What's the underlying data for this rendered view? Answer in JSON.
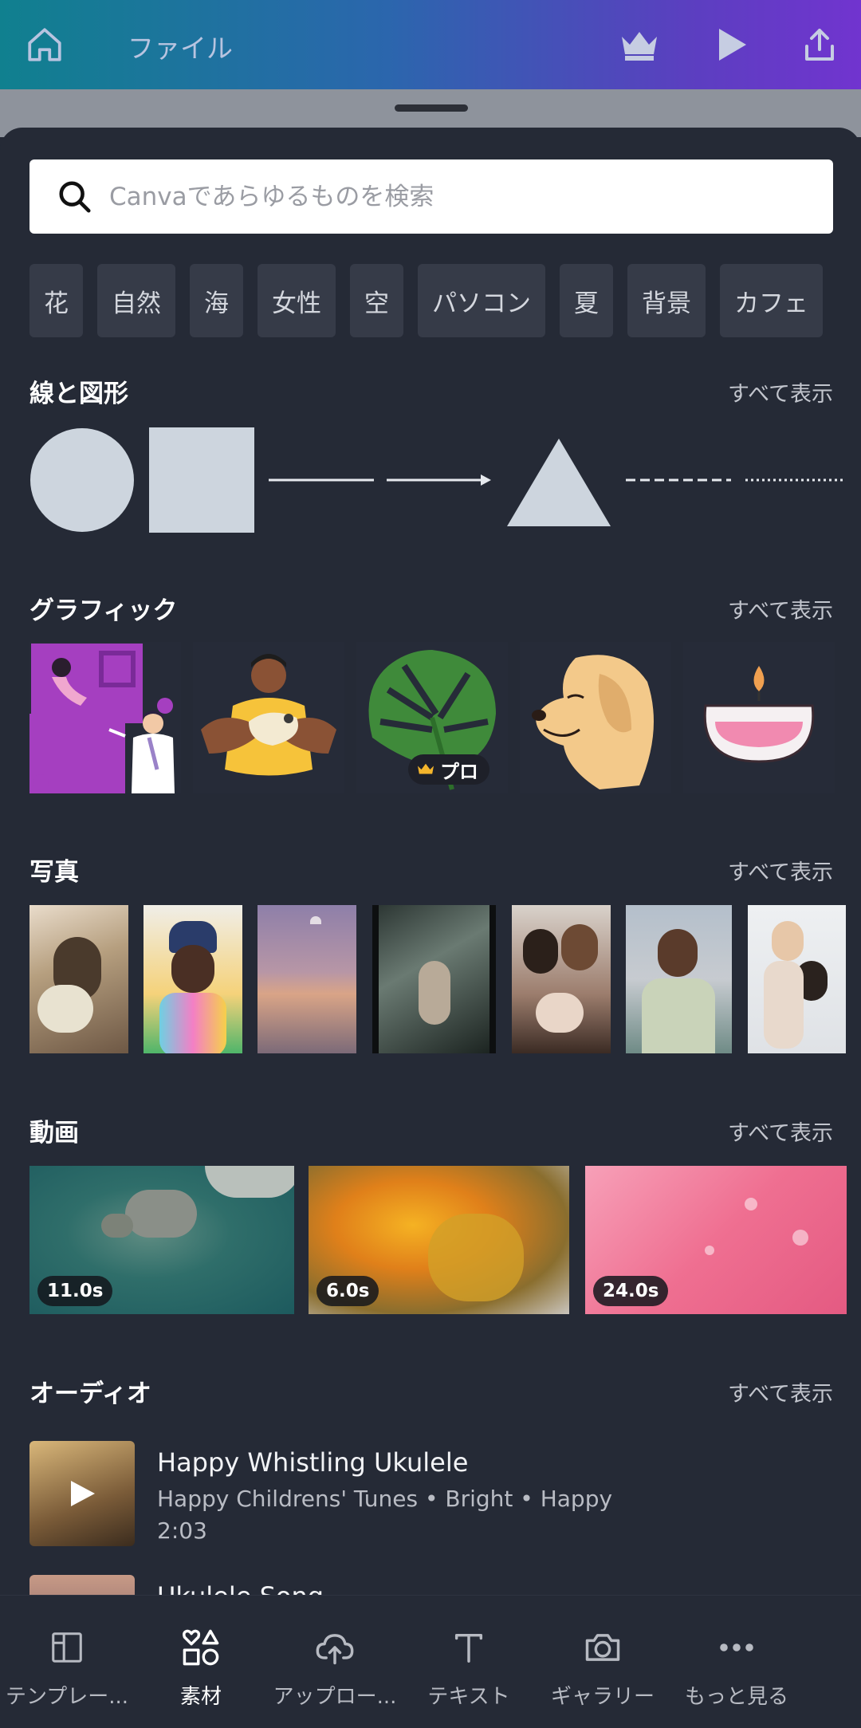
{
  "topbar": {
    "title": "ファイル",
    "icons": [
      "home-icon",
      "crown-icon",
      "play-icon",
      "share-icon"
    ],
    "gradient": [
      "#10808f",
      "#7134cf"
    ]
  },
  "search": {
    "placeholder": "Canvaであらゆるものを検索",
    "value": ""
  },
  "chips": [
    "花",
    "自然",
    "海",
    "女性",
    "空",
    "パソコン",
    "夏",
    "背景",
    "カフェ"
  ],
  "sections": {
    "shapes": {
      "title": "線と図形",
      "see_all": "すべて表示"
    },
    "graphics": {
      "title": "グラフィック",
      "see_all": "すべて表示",
      "pro_label": "プロ"
    },
    "photos": {
      "title": "写真",
      "see_all": "すべて表示"
    },
    "videos": {
      "title": "動画",
      "see_all": "すべて表示",
      "items": [
        {
          "duration": "11.0s"
        },
        {
          "duration": "6.0s"
        },
        {
          "duration": "24.0s"
        }
      ]
    },
    "audio": {
      "title": "オーディオ",
      "see_all": "すべて表示",
      "tracks": [
        {
          "title": "Happy Whistling Ukulele",
          "meta": "Happy Childrens' Tunes • Bright • Happy",
          "duration": "2:03"
        },
        {
          "title": "Ukulele Song"
        }
      ]
    }
  },
  "bottom_nav": [
    {
      "label": "テンプレー...",
      "icon": "template-icon",
      "active": false
    },
    {
      "label": "素材",
      "icon": "elements-icon",
      "active": true
    },
    {
      "label": "アップロー...",
      "icon": "upload-icon",
      "active": false
    },
    {
      "label": "テキスト",
      "icon": "text-icon",
      "active": false
    },
    {
      "label": "ギャラリー",
      "icon": "camera-icon",
      "active": false
    },
    {
      "label": "もっと見る",
      "icon": "more-icon",
      "active": false
    }
  ],
  "colors": {
    "background": "#252a36",
    "shape_fill": "#cdd5de",
    "chip": "#363b48"
  }
}
